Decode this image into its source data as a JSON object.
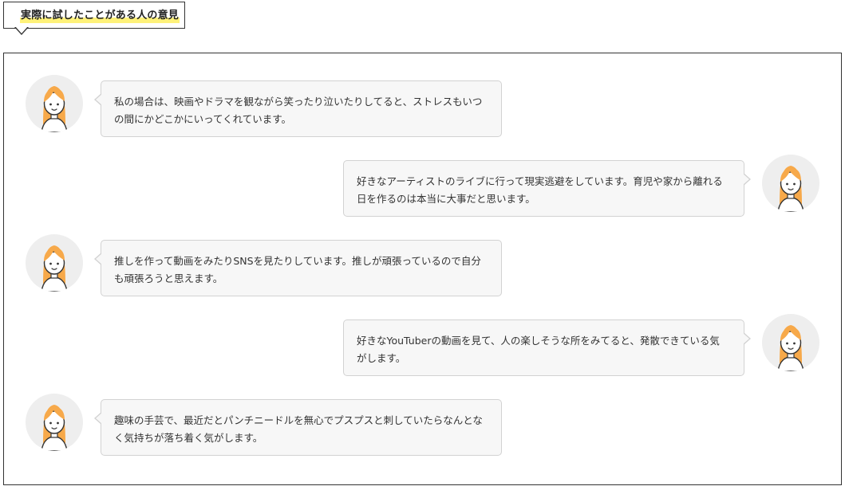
{
  "header": {
    "title": "実際に試したことがある人の意見"
  },
  "colors": {
    "highlight": "#fff27a",
    "bubble_bg": "#f7f7f7",
    "bubble_border": "#d2d2d2",
    "avatar_bg": "#eeeeee",
    "hair": "#f7a94a"
  },
  "messages": [
    {
      "side": "left",
      "avatar_icon": "woman-avatar-icon",
      "text": "私の場合は、映画やドラマを観ながら笑ったり泣いたりしてると、ストレスもいつの間にかどこかにいってくれています。"
    },
    {
      "side": "right",
      "avatar_icon": "woman-avatar-icon",
      "text": "好きなアーティストのライブに行って現実逃避をしています。育児や家から離れる日を作るのは本当に大事だと思います。"
    },
    {
      "side": "left",
      "avatar_icon": "woman-avatar-icon",
      "text": "推しを作って動画をみたりSNSを見たりしています。推しが頑張っているので自分も頑張ろうと思えます。"
    },
    {
      "side": "right",
      "avatar_icon": "woman-avatar-icon",
      "text": "好きなYouTuberの動画を見て、人の楽しそうな所をみてると、発散できている気がします。"
    },
    {
      "side": "left",
      "avatar_icon": "woman-avatar-icon",
      "text": "趣味の手芸で、最近だとパンチニードルを無心でプスプスと刺していたらなんとなく気持ちが落ち着く気がします。"
    }
  ]
}
